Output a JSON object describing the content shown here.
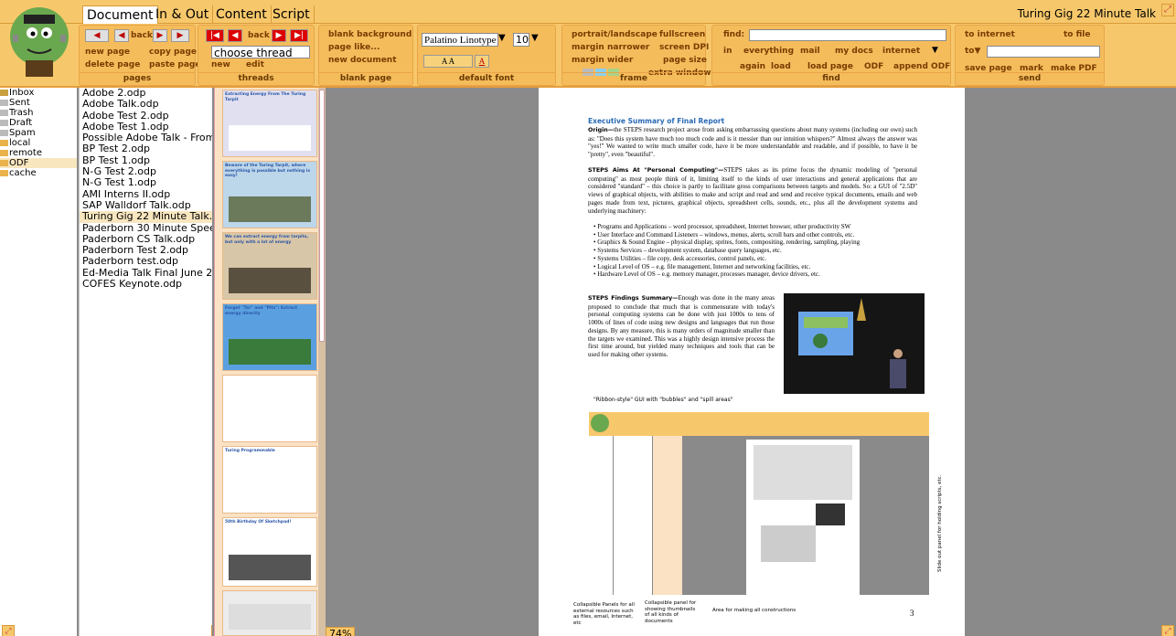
{
  "tabs": [
    "Document",
    "In & Out",
    "Content",
    "Script"
  ],
  "window_title": "Turing Gig 22 Minute Talk",
  "ribbon": {
    "pages": {
      "title": "pages",
      "back": "back",
      "new_page": "new page",
      "copy_page": "copy page",
      "delete_page": "delete page",
      "paste_page": "paste page"
    },
    "threads": {
      "title": "threads",
      "back": "back",
      "choose": "choose thread",
      "new": "new",
      "edit": "edit"
    },
    "blank_page": {
      "title": "blank page",
      "blank_background": "blank background",
      "page_like": "page like...",
      "new_document": "new document"
    },
    "default_font": {
      "title": "default font",
      "font": "Palatino Linotype",
      "size": "10"
    },
    "frame": {
      "title": "frame",
      "portrait": "portrait/landscape",
      "fullscreen": "fullscreen",
      "margin_narrower": "margin narrower",
      "screen_dpi": "screen DPI",
      "margin_wider": "margin wider",
      "page_size": "page size",
      "extra_window": "extra window"
    },
    "find": {
      "title": "find",
      "find_label": "find:",
      "in": "in",
      "everything": "everything",
      "mail": "mail",
      "my_docs": "my docs",
      "internet": "internet",
      "again": "again",
      "load": "load",
      "load_page": "load page",
      "odf": "ODF",
      "append_odf": "append ODF"
    },
    "send": {
      "title": "send",
      "to_internet": "to internet",
      "to_file": "to file",
      "to": "to▼",
      "save_page": "save page",
      "mark": "mark",
      "make_pdf": "make PDF"
    }
  },
  "folders": [
    "Inbox",
    "Sent",
    "Trash",
    "Draft",
    "Spam",
    "local",
    "remote",
    "ODF",
    "cache"
  ],
  "folder_selected": 7,
  "docs": [
    "Adobe 2.odp",
    "Adobe Talk.odp",
    "Adobe Test 2.odp",
    "Adobe Test 1.odp",
    "Possible Adobe Talk - From Pac",
    "BP Test 2.odp",
    "BP Test 1.odp",
    "N-G Test 2.odp",
    "N-G Test 1.odp",
    "AMI Interns II.odp",
    "SAP Walldorf Talk.odp",
    "Turing Gig 22 Minute Talk.odp",
    "Paderborn 30 Minute Speech.o",
    "Paderborn CS Talk.odp",
    "Paderborn Test 2.odp",
    "Paderborn test.odp",
    "Ed-Media Talk Final June 26 20",
    "COFES Keynote.odp"
  ],
  "doc_selected": 11,
  "thumbs": [
    "Extracting Energy From The Turing Tarpit",
    "Beware of the Turing Tarpit, where everything is possible but nothing is easy!",
    "We can extract energy from tarpits, but only with a lot of energy",
    "Forget \"Tar\" and \"Pits\": Extract energy directly",
    "",
    "Turing Programmable",
    "50th Birthday Of Sketchpad!",
    ""
  ],
  "zoom": "74%",
  "page": {
    "heading": "Executive Summary of Final Report",
    "origin_label": "Origin—",
    "origin": "the STEPS research project arose from asking embarrassing questions about many systems (including our own) such as: \"Does this system have much too much code and is it messier than our intuition whispers?\" Almost always the answer was \"yes!\" We wanted to write much smaller code, have it be more understandable and readable, and if possible, to have it be \"pretty\", even \"beautiful\".",
    "aims_label": "STEPS Aims At \"Personal Computing\"—",
    "aims": "STEPS takes as its prime focus the dynamic modeling of \"personal computing\" as most people think of it, limiting itself to the kinds of user interactions and general applications that are considered \"standard\" – this choice is partly to facilitate gross comparisons between targets and models. So: a GUI of \"2.5D\" views of graphical objects, with abilities to make and script and read and send and receive typical documents, emails and web pages made from text, pictures, graphical objects, spreadsheet cells, sounds, etc., plus all the development systems and underlying machinery:",
    "bullets": [
      "Programs and Applications – word processor, spreadsheet, Internet browser, other productivity SW",
      "User Interface and Command Listeners – windows, menus, alerts, scroll bars and other controls, etc.",
      "Graphics & Sound Engine – physical display, sprites, fonts, compositing, rendering, sampling, playing",
      "Systems Services – development system, database query languages, etc.",
      "Systems Utilities – file copy, desk accessories, control panels, etc.",
      "Logical Level of OS – e.g. file management, Internet and networking facilities, etc.",
      "Hardware Level of OS – e.g. memory manager, processes manager, device drivers, etc."
    ],
    "findings_label": "STEPS Findings Summary—",
    "findings": "Enough was done in the many areas proposed to conclude that much that is commensurate with today's personal computing systems can be done with just 1000s to tens of 1000s of lines of code using new designs and languages that run those designs. By any measure, this is many orders of magnitude smaller than the targets we examined. This was a highly design intensive process the first time around, but yielded many techniques and tools that can be used for making other systems.",
    "photo_caption": "\"Ribbon-style\" GUI with \"bubbles\" and \"spill areas\"",
    "side_caption": "Slide out panel for holding scripts, etc.",
    "cap1": "Collapsible Panels for all external resources such as files, email, Internet, etc",
    "cap2": "Collapsible panel for showing thumbnails of all kinds of documents",
    "cap3": "Area for making all constructions",
    "page_number": "3"
  },
  "colors": {
    "ribbon": "#f7c86b",
    "accent": "#e59d3b",
    "heading": "#2a6ab6"
  }
}
